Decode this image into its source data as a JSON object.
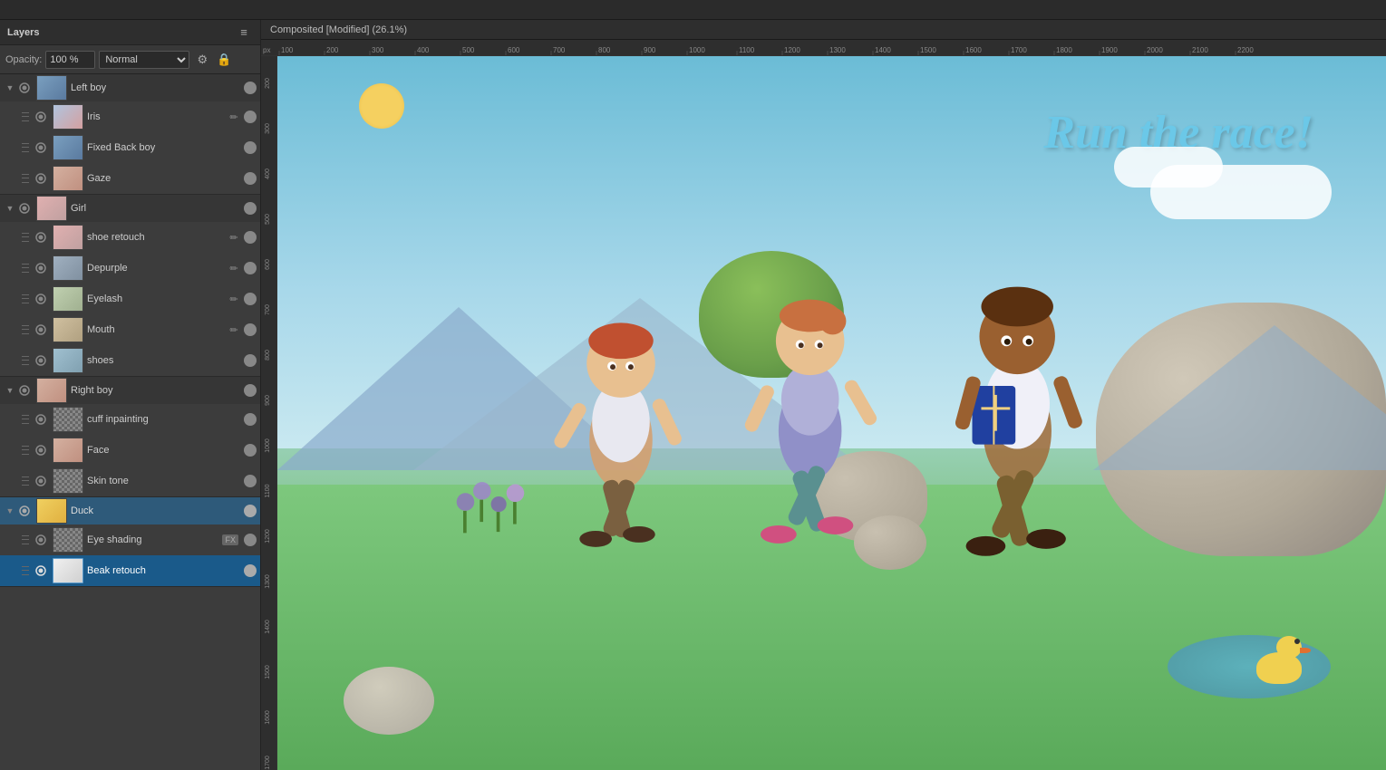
{
  "app": {
    "title": "Layers",
    "canvas_title": "Composited [Modified] (26.1%)"
  },
  "toolbar": {
    "opacity_label": "Opacity:",
    "opacity_value": "100 %",
    "blend_mode": "Normal",
    "settings_icon": "⚙",
    "menu_icon": "≡",
    "lock_icon": "🔒"
  },
  "layers": {
    "groups": [
      {
        "id": "left-boy-group",
        "name": "Left boy",
        "expanded": true,
        "children": [
          {
            "id": "iris",
            "name": "Iris",
            "has_edit": true,
            "thumb_class": "thumb-color-1"
          },
          {
            "id": "fixed-back-boy",
            "name": "Fixed Back boy",
            "has_edit": false,
            "thumb_class": "thumb-color-2"
          },
          {
            "id": "gaze",
            "name": "Gaze",
            "has_edit": false,
            "thumb_class": "thumb-color-3"
          }
        ]
      },
      {
        "id": "girl-group",
        "name": "Girl",
        "expanded": true,
        "children": [
          {
            "id": "shoe-retouch",
            "name": "shoe retouch",
            "has_edit": true,
            "thumb_class": "thumb-color-4"
          },
          {
            "id": "depurple",
            "name": "Depurple",
            "has_edit": true,
            "thumb_class": "thumb-color-5"
          },
          {
            "id": "eyelash",
            "name": "Eyelash",
            "has_edit": true,
            "thumb_class": "thumb-color-6"
          },
          {
            "id": "mouth",
            "name": "Mouth",
            "has_edit": true,
            "thumb_class": "thumb-color-7"
          },
          {
            "id": "shoes",
            "name": "shoes",
            "has_edit": false,
            "thumb_class": "thumb-color-8"
          }
        ]
      },
      {
        "id": "right-boy-group",
        "name": "Right boy",
        "expanded": true,
        "children": [
          {
            "id": "cuff-inpainting",
            "name": "cuff inpainting",
            "has_edit": false,
            "thumb_class": "thumb-color-1"
          },
          {
            "id": "face",
            "name": "Face",
            "has_edit": false,
            "thumb_class": "thumb-color-3"
          },
          {
            "id": "skin-tone",
            "name": "Skin tone",
            "has_edit": false,
            "thumb_class": "thumb-color-5"
          }
        ]
      },
      {
        "id": "duck-group",
        "name": "Duck",
        "expanded": true,
        "children": [
          {
            "id": "eye-shading",
            "name": "Eye shading",
            "has_fx": true,
            "thumb_class": "thumb-checker"
          },
          {
            "id": "beak-retouch",
            "name": "Beak retouch",
            "active": true,
            "thumb_class": "thumb-beak"
          }
        ]
      }
    ]
  },
  "canvas": {
    "title_text": "Run the race!"
  }
}
